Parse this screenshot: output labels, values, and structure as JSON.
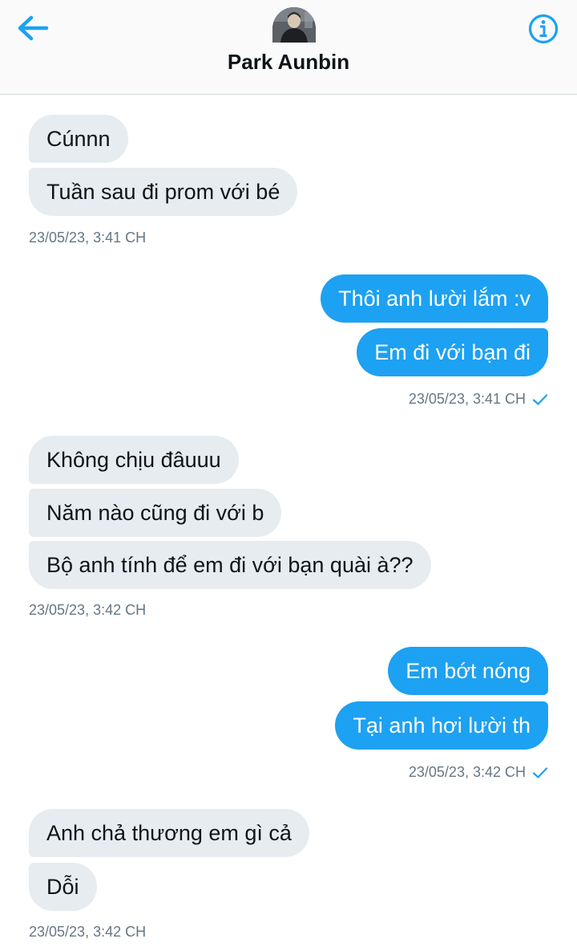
{
  "header": {
    "contact_name": "Park Aunbin"
  },
  "messages": [
    {
      "text": "Cúnnn",
      "direction": "incoming"
    },
    {
      "text": "Tuần sau đi prom với bé",
      "direction": "incoming"
    },
    {
      "text": "Thôi anh lười lắm :v",
      "direction": "outgoing"
    },
    {
      "text": "Em đi với bạn đi",
      "direction": "outgoing"
    },
    {
      "text": "Không chịu đâuuu",
      "direction": "incoming"
    },
    {
      "text": "Năm nào cũng đi với b",
      "direction": "incoming"
    },
    {
      "text": "Bộ anh tính để em đi với bạn quài à??",
      "direction": "incoming"
    },
    {
      "text": "Em bớt nóng",
      "direction": "outgoing"
    },
    {
      "text": "Tại anh hơi lười th",
      "direction": "outgoing"
    },
    {
      "text": "Anh chả thương em gì cả",
      "direction": "incoming"
    },
    {
      "text": "Dỗi",
      "direction": "incoming"
    }
  ],
  "timestamps": [
    {
      "text": "23/05/23, 3:41 CH"
    },
    {
      "text": "23/05/23, 3:41 CH",
      "read": true
    },
    {
      "text": "23/05/23, 3:42 CH"
    },
    {
      "text": "23/05/23, 3:42 CH",
      "read": true
    },
    {
      "text": "23/05/23, 3:42 CH"
    }
  ],
  "colors": {
    "accent": "#1da1f2",
    "incoming_bubble": "#e6ecf0",
    "timestamp": "#657786"
  },
  "icons": {
    "back": "arrow-left-icon",
    "info": "info-circle-icon",
    "read": "checkmark-icon"
  }
}
